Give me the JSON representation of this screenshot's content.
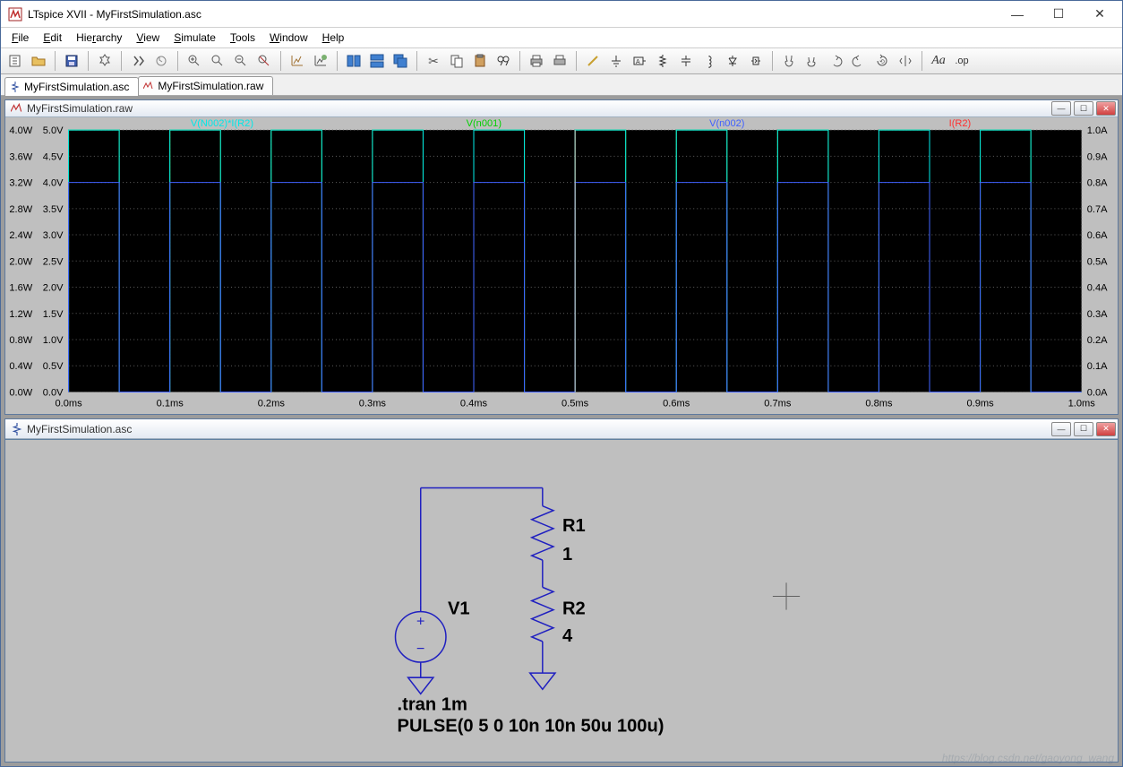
{
  "app": {
    "title": "LTspice XVII - MyFirstSimulation.asc"
  },
  "menu": {
    "items": [
      "File",
      "Edit",
      "Hierarchy",
      "View",
      "Simulate",
      "Tools",
      "Window",
      "Help"
    ]
  },
  "tabs": [
    {
      "label": "MyFirstSimulation.asc",
      "type": "asc"
    },
    {
      "label": "MyFirstSimulation.raw",
      "type": "raw"
    }
  ],
  "plot": {
    "title": "MyFirstSimulation.raw",
    "traces": [
      {
        "name": "V(N002)*I(R2)",
        "color": "#00e8e8"
      },
      {
        "name": "V(n001)",
        "color": "#00d000"
      },
      {
        "name": "I(R2)",
        "color": "#ff3030"
      },
      {
        "name": "V(n002)",
        "color": "#4060ff"
      }
    ],
    "left_axis": {
      "ticks": [
        "4.0W",
        "3.6W",
        "3.2W",
        "2.8W",
        "2.4W",
        "2.0W",
        "1.6W",
        "1.2W",
        "0.8W",
        "0.4W",
        "0.0W"
      ]
    },
    "left2_axis": {
      "ticks": [
        "5.0V",
        "4.5V",
        "4.0V",
        "3.5V",
        "3.0V",
        "2.5V",
        "2.0V",
        "1.5V",
        "1.0V",
        "0.5V",
        "0.0V"
      ]
    },
    "right_axis": {
      "ticks": [
        "1.0A",
        "0.9A",
        "0.8A",
        "0.7A",
        "0.6A",
        "0.5A",
        "0.4A",
        "0.3A",
        "0.2A",
        "0.1A",
        "0.0A"
      ]
    },
    "x_axis": {
      "ticks": [
        "0.0ms",
        "0.1ms",
        "0.2ms",
        "0.3ms",
        "0.4ms",
        "0.5ms",
        "0.6ms",
        "0.7ms",
        "0.8ms",
        "0.9ms",
        "1.0ms"
      ]
    }
  },
  "schematic": {
    "title": "MyFirstSimulation.asc",
    "labels": {
      "v1": "V1",
      "r1_name": "R1",
      "r1_val": "1",
      "r2_name": "R2",
      "r2_val": "4"
    },
    "directive": ".tran 1m",
    "source_spec": "PULSE(0 5 0 10n 10n 50u 100u)"
  },
  "chart_data": {
    "type": "line",
    "title": "MyFirstSimulation.raw",
    "xlabel": "",
    "ylabel": "",
    "x_range_ms": [
      0,
      1.0
    ],
    "waveform": "square_pulse",
    "period_us": 100,
    "on_time_us": 50,
    "rise_ns": 10,
    "fall_ns": 10,
    "series": [
      {
        "name": "V(N002)*I(R2)",
        "high": 4.0,
        "low": 0.0,
        "unit": "W",
        "color": "#00e8e8"
      },
      {
        "name": "V(n001)",
        "high": 5.0,
        "low": 0.0,
        "unit": "V",
        "color": "#00d000"
      },
      {
        "name": "V(n002)",
        "high": 4.0,
        "low": 0.0,
        "unit": "V",
        "color": "#4060ff"
      },
      {
        "name": "I(R2)",
        "high": 1.0,
        "low": 0.0,
        "unit": "A",
        "color": "#ff3030"
      }
    ],
    "left_axis_W": {
      "min": 0,
      "max": 4.0,
      "step": 0.4
    },
    "left_axis_V": {
      "min": 0,
      "max": 5.0,
      "step": 0.5
    },
    "right_axis_A": {
      "min": 0,
      "max": 1.0,
      "step": 0.1
    },
    "x_axis_ms": {
      "min": 0,
      "max": 1.0,
      "step": 0.1
    }
  }
}
